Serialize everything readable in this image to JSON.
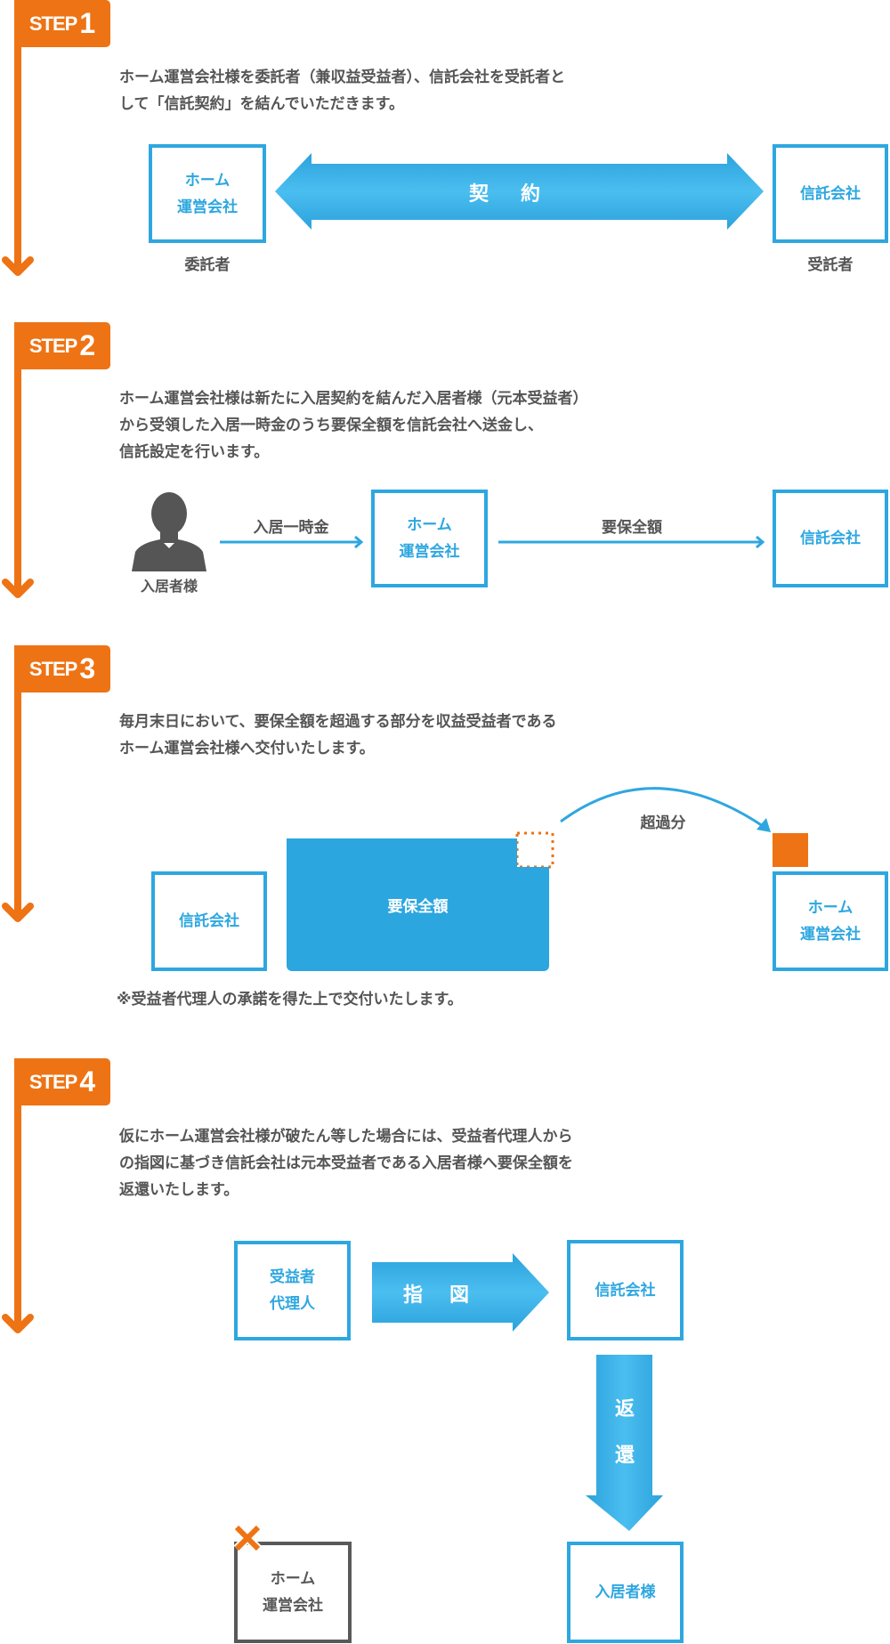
{
  "colors": {
    "accent_orange": "#ee7314",
    "accent_blue": "#2ea7e0",
    "text_gray": "#555555",
    "failed_gray": "#595959"
  },
  "steps": [
    {
      "prefix": "STEP",
      "number": "1",
      "text": "ホーム運営会社様を委託者（兼収益受益者）、信託会社を受託者と\nして「信託契約」を結んでいただきます。",
      "left_box": "ホーム\n運営会社",
      "left_caption": "委託者",
      "arrow_label": "契約",
      "right_box": "信託会社",
      "right_caption": "受託者"
    },
    {
      "prefix": "STEP",
      "number": "2",
      "text": "ホーム運営会社様は新たに入居契約を結んだ入居者様（元本受益者）\nから受領した入居一時金のうち要保全額を信託会社へ送金し、\n信託設定を行います。",
      "person_icon": "person-silhouette-icon",
      "person_caption": "入居者様",
      "flow1_label": "入居一時金",
      "middle_box": "ホーム\n運営会社",
      "flow2_label": "要保全額",
      "right_box": "信託会社"
    },
    {
      "prefix": "STEP",
      "number": "3",
      "text": "毎月末日において、要保全額を超過する部分を収益受益者である\nホーム運営会社様へ交付いたします。",
      "left_box": "信託会社",
      "fund_block": "要保全額",
      "excess_label": "超過分",
      "right_box": "ホーム\n運営会社",
      "note": "※受益者代理人の承諾を得た上で交付いたします。"
    },
    {
      "prefix": "STEP",
      "number": "4",
      "text": "仮にホーム運営会社様が破たん等した場合には、受益者代理人から\nの指図に基づき信託会社は元本受益者である入居者様へ要保全額を\n返還いたします。",
      "agent_box": "受益者\n代理人",
      "instruction_label": "指図",
      "trust_box": "信託会社",
      "return_label": [
        "返",
        "還"
      ],
      "failed_box": "ホーム\n運営会社",
      "failed_icon": "cross-icon",
      "resident_box": "入居者様"
    }
  ]
}
